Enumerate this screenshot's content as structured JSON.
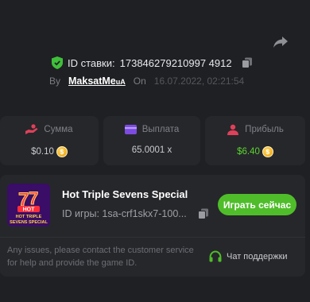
{
  "bet": {
    "id_label": "ID ставки:",
    "id_value": "173846279210997 4912",
    "by_label": "By",
    "user": "MaksatMe",
    "user_suffix": "uA",
    "on_label": "On",
    "date": "16.07.2022, 02:21:54"
  },
  "stats": {
    "amount": {
      "label": "Сумма",
      "value": "$0.10"
    },
    "payout": {
      "label": "Выплата",
      "value": "65.0001 x"
    },
    "profit": {
      "label": "Прибыль",
      "value": "$6.40"
    }
  },
  "game": {
    "title": "Hot Triple Sevens Special",
    "id_text": "ID игры: 1sa-crf1skx7-100...",
    "play_label": "Играть сейчас",
    "thumb_top": "HOT",
    "thumb_line1": "HOT TRIPLE",
    "thumb_line2": "SEVENS SPECIAL"
  },
  "help": {
    "text": "Any issues, please contact the customer service for help and provide the game ID.",
    "support_label": "Чат поддержки"
  },
  "colors": {
    "accent_green": "#4fbd2a",
    "profit_green": "#5bd32e",
    "background": "#1f2023",
    "card": "#26272b"
  }
}
